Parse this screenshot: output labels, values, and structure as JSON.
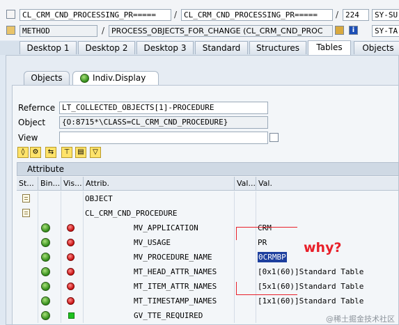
{
  "header": {
    "row1": {
      "field_a": "CL_CRM_CND_PROCESSING_PR=====",
      "field_b": "CL_CRM_CND_PROCESSING_PR=====",
      "field_c": "224",
      "field_d": "SY-SU"
    },
    "row2": {
      "field_a": "METHOD",
      "field_b": "PROCESS_OBJECTS_FOR_CHANGE (CL_CRM_CND_PROC",
      "field_c": "SY-TA"
    }
  },
  "tabs": [
    "Desktop 1",
    "Desktop 2",
    "Desktop 3",
    "Standard",
    "Structures",
    "Tables",
    "Objects"
  ],
  "subtabs": {
    "objects": "Objects",
    "indiv": "Indiv.Display"
  },
  "form": {
    "reference_label": "Refernce",
    "reference_value": "LT_COLLECTED_OBJECTS[1]-PROCEDURE",
    "object_label": "Object",
    "object_value": "{O:8715*\\CLASS=CL_CRM_CND_PROCEDURE}",
    "view_label": "View",
    "view_value": ""
  },
  "table": {
    "section_title": "Attribute",
    "columns": {
      "st": "St...",
      "bin": "Bin...",
      "vis": "Vis...",
      "attrib": "Attrib.",
      "val_short": "Val...",
      "val": "Val."
    },
    "rows": [
      {
        "attrib": "OBJECT",
        "val": ""
      },
      {
        "attrib": "CL_CRM_CND_PROCEDURE",
        "val": ""
      },
      {
        "attrib": "MV_APPLICATION",
        "val": "CRM"
      },
      {
        "attrib": "MV_USAGE",
        "val": "PR"
      },
      {
        "attrib": "MV_PROCEDURE_NAME",
        "val": "0CRMBP"
      },
      {
        "attrib": "MT_HEAD_ATTR_NAMES",
        "val": "[0x1(60)]Standard Table"
      },
      {
        "attrib": "MT_ITEM_ATTR_NAMES",
        "val": "[5x1(60)]Standard Table"
      },
      {
        "attrib": "MT_TIMESTAMP_NAMES",
        "val": "[1x1(60)]Standard Table"
      },
      {
        "attrib": "GV_TTE_REQUIRED",
        "val": ""
      }
    ]
  },
  "annotation": {
    "text": "why?",
    "color": "#e8202a"
  },
  "watermark": "@稀土掘金技术社区"
}
